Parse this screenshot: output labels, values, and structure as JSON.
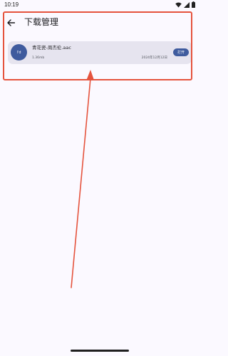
{
  "status_bar": {
    "time": "10:19",
    "icons": [
      "wifi-icon",
      "signal-icon",
      "battery-icon"
    ]
  },
  "app_bar": {
    "title": "下载管理",
    "back_icon": "arrow-left-icon"
  },
  "downloads": [
    {
      "avatar_text": "I'd",
      "file_name": "青花瓷-周杰伦.aac",
      "size": "1.36mb",
      "date": "2024年12月12日",
      "open_label": "打开"
    }
  ],
  "colors": {
    "background": "#fbf9ff",
    "card_background": "#e6e4ef",
    "accent": "#3f5b9e",
    "annotation": "#e5533d"
  }
}
